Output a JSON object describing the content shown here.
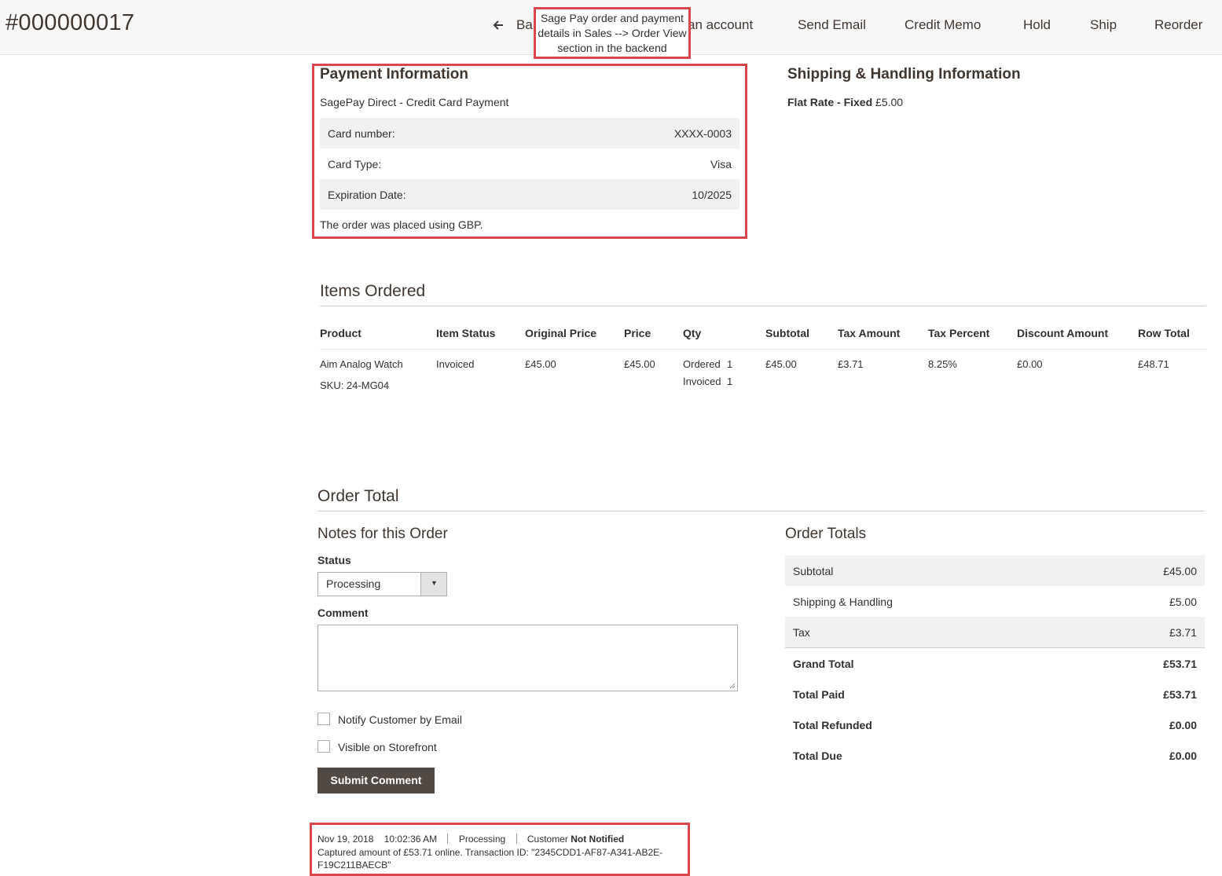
{
  "header": {
    "order_number": "#000000017",
    "toolbar": {
      "back_label": "Ba",
      "login_as_customer_label": "an account",
      "send_email_label": "Send Email",
      "credit_memo_label": "Credit Memo",
      "hold_label": "Hold",
      "ship_label": "Ship",
      "reorder_label": "Reorder"
    },
    "annotation_tooltip": "Sage Pay order and payment details in Sales --> Order View section in the backend"
  },
  "payment": {
    "title": "Payment Information",
    "method": "SagePay Direct - Credit Card Payment",
    "rows": [
      {
        "label": "Card number:",
        "value": "XXXX-0003"
      },
      {
        "label": "Card Type:",
        "value": "Visa"
      },
      {
        "label": "Expiration Date:",
        "value": "10/2025"
      }
    ],
    "currency_note": "The order was placed using GBP."
  },
  "shipping": {
    "title": "Shipping & Handling Information",
    "method_bold": "Flat Rate - Fixed",
    "price": "£5.00"
  },
  "items": {
    "title": "Items Ordered",
    "columns": [
      "Product",
      "Item Status",
      "Original Price",
      "Price",
      "Qty",
      "Subtotal",
      "Tax Amount",
      "Tax Percent",
      "Discount Amount",
      "Row Total"
    ],
    "rows": [
      {
        "product": "Aim Analog Watch",
        "sku": "SKU: 24-MG04",
        "status": "Invoiced",
        "original_price": "£45.00",
        "price": "£45.00",
        "qty_ordered_label": "Ordered",
        "qty_ordered": "1",
        "qty_invoiced_label": "Invoiced",
        "qty_invoiced": "1",
        "subtotal": "£45.00",
        "tax_amount": "£3.71",
        "tax_percent": "8.25%",
        "discount": "£0.00",
        "row_total": "£48.71"
      }
    ]
  },
  "order_total": {
    "title": "Order Total",
    "notes": {
      "title": "Notes for this Order",
      "status_label": "Status",
      "status_value": "Processing",
      "comment_label": "Comment",
      "comment_value": "",
      "notify_label": "Notify Customer by Email",
      "visible_label": "Visible on Storefront",
      "submit_label": "Submit Comment"
    },
    "totals": {
      "title": "Order Totals",
      "rows": [
        {
          "label": "Subtotal",
          "value": "£45.00"
        },
        {
          "label": "Shipping & Handling",
          "value": "£5.00"
        },
        {
          "label": "Tax",
          "value": "£3.71"
        },
        {
          "label": "Grand Total",
          "value": "£53.71"
        },
        {
          "label": "Total Paid",
          "value": "£53.71"
        },
        {
          "label": "Total Refunded",
          "value": "£0.00"
        },
        {
          "label": "Total Due",
          "value": "£0.00"
        }
      ]
    }
  },
  "history": {
    "date": "Nov 19, 2018",
    "time": "10:02:36 AM",
    "status": "Processing",
    "customer_label": "Customer",
    "notified": "Not Notified",
    "message": "Captured amount of £53.71 online. Transaction ID: \"2345CDD1-AF87-A341-AB2E-F19C211BAECB\""
  },
  "colors": {
    "annotation_border": "#d9464b",
    "button_dark": "#514943",
    "row_shade": "#f1f1f1"
  }
}
